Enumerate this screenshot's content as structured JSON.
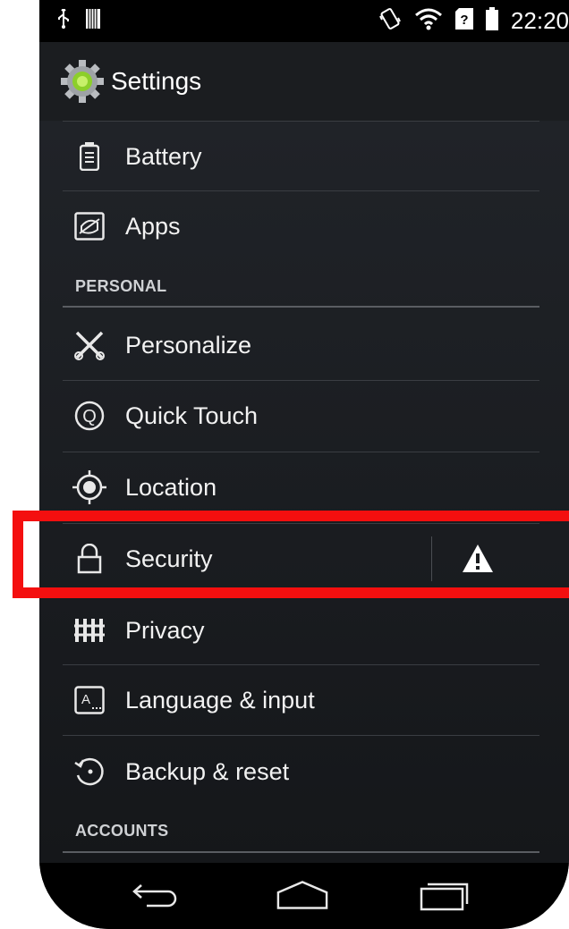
{
  "status_bar": {
    "time": "22:20",
    "icons": [
      "usb-icon",
      "sim-bars-icon",
      "vibrate-icon",
      "wifi-icon",
      "no-sim-icon",
      "battery-icon"
    ]
  },
  "action_bar": {
    "title": "Settings",
    "icon": "settings-gear-icon"
  },
  "settings": {
    "items_top": [
      {
        "label": "Battery",
        "icon": "battery-icon"
      },
      {
        "label": "Apps",
        "icon": "apps-icon"
      }
    ],
    "personal_header": "PERSONAL",
    "personal_items": [
      {
        "label": "Personalize",
        "icon": "tools-icon"
      },
      {
        "label": "Quick Touch",
        "icon": "quick-touch-icon"
      },
      {
        "label": "Location",
        "icon": "location-icon"
      },
      {
        "label": "Security",
        "icon": "lock-icon",
        "badge": "warning-icon"
      },
      {
        "label": "Privacy",
        "icon": "privacy-fence-icon"
      },
      {
        "label": "Language & input",
        "icon": "keyboard-language-icon"
      },
      {
        "label": "Backup & reset",
        "icon": "backup-restore-icon"
      }
    ],
    "accounts_header": "ACCOUNTS"
  },
  "nav_bar": {
    "buttons": [
      "back-icon",
      "home-icon",
      "recents-icon"
    ]
  },
  "colors": {
    "highlight": "#f40f0f",
    "background": "#1b1d20"
  }
}
